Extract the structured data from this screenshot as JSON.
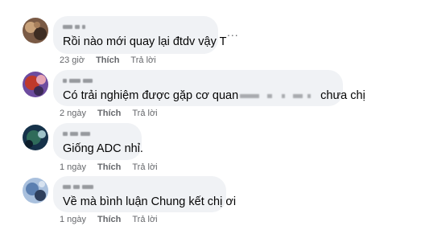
{
  "comments": [
    {
      "text": "Rồi nào mới quay lại đtdv vậy T",
      "time": "23 giờ",
      "like_label": "Thích",
      "reply_label": "Trả lời",
      "avatar_colors": [
        "#7a5a45",
        "#c9a27a",
        "#3d2c22"
      ]
    },
    {
      "text_before": "Có trải nghiệm được gặp cơ quan",
      "text_after": "chưa chị",
      "time": "2 ngày",
      "like_label": "Thích",
      "reply_label": "Trả lời",
      "avatar_colors": [
        "#c0392b",
        "#6d4c9f",
        "#e6a5b5"
      ]
    },
    {
      "text": "Giống ADC nhỉ.",
      "time": "1 ngày",
      "like_label": "Thích",
      "reply_label": "Trả lời",
      "avatar_colors": [
        "#2f6b5a",
        "#16324a",
        "#9fc3c9"
      ]
    },
    {
      "text": "Về mà bình luận Chung kết chị ơi",
      "time": "1 ngày",
      "like_label": "Thích",
      "reply_label": "Trả lời",
      "avatar_colors": [
        "#5b7fb0",
        "#a9c0dd",
        "#2e3f5c"
      ]
    }
  ],
  "more_label": "..."
}
